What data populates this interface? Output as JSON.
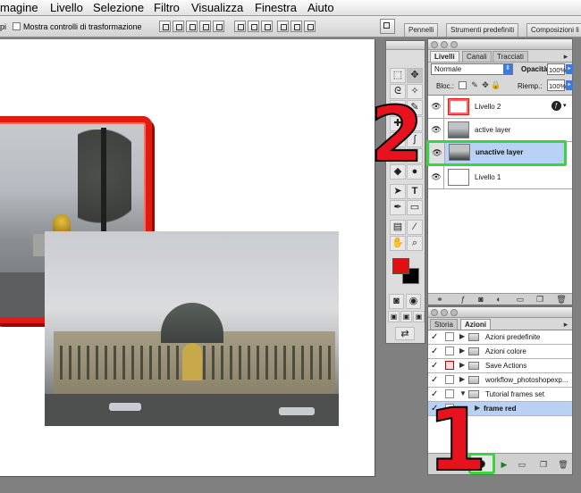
{
  "menubar": {
    "items": [
      "magine",
      "Livello",
      "Selezione",
      "Filtro",
      "Visualizza",
      "Finestra",
      "Aiuto"
    ]
  },
  "optionsbar": {
    "partial_label": "pi",
    "show_transform_label": "Mostra controlli di trasformazione"
  },
  "docktabs": [
    "Pennelli",
    "Strumenti predefiniti",
    "Composizioni li"
  ],
  "layers_panel": {
    "tabs": [
      "Livelli",
      "Canali",
      "Tracciati"
    ],
    "blend_mode": "Normale",
    "opacity_label": "Opacità:",
    "opacity_value": "100%",
    "lock_label": "Bloc.:",
    "fill_label": "Riemp.:",
    "fill_value": "100%",
    "layers": [
      {
        "name": "Livello 2"
      },
      {
        "name": "active layer"
      },
      {
        "name": "unactive layer"
      },
      {
        "name": "Livello 1"
      }
    ]
  },
  "actions_panel": {
    "tabs": [
      "Storia",
      "Azioni"
    ],
    "items": [
      {
        "name": "Azioni predefinite"
      },
      {
        "name": "Azioni colore"
      },
      {
        "name": "Save Actions"
      },
      {
        "name": "workflow_photoshopexp..."
      },
      {
        "name": "Tutorial frames set"
      },
      {
        "name": "frame red"
      }
    ]
  },
  "annotations": {
    "step1": "1",
    "step2": "2"
  },
  "colors": {
    "highlight_green": "#3bd43b",
    "frame_red": "#e21a10",
    "annotation_red": "#e6121e",
    "foreground": "#e01010",
    "background": "#000000"
  }
}
